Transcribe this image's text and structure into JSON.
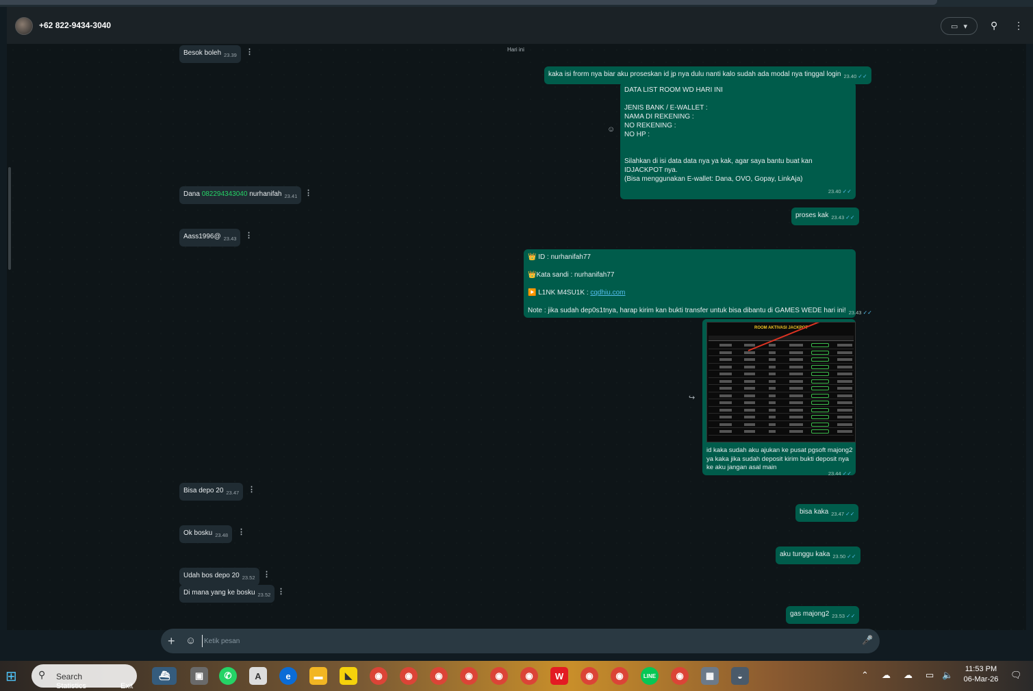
{
  "header": {
    "contact": "+62 822-9434-3040",
    "video_icon": "video-camera-icon",
    "search_icon": "search-icon",
    "menu_icon": "more-vert-icon"
  },
  "chat": {
    "date_chip": "Hari ini",
    "messages": [
      {
        "dir": "in",
        "text": "Besok boleh",
        "time": "23.39"
      },
      {
        "dir": "out",
        "text": "kaka isi frorm nya biar aku proseskan id jp nya dulu nanti kalo sudah ada modal nya tinggal login",
        "time": "23.40"
      },
      {
        "dir": "out",
        "text": "DATA LIST ROOM WD HARI INI\n\nJENIS BANK / E-WALLET :\nNAMA DI REKENING :\nNO REKENING :\nNO HP :\n\n\nSilahkan di isi data data nya ya kak, agar saya bantu buat kan IDJACKPOT nya.\n(Bisa menggunakan E-wallet: Dana, OVO, Gopay, LinkAja)",
        "time": "23.40"
      },
      {
        "dir": "in",
        "prefix": "Dana ",
        "phone": "082294343040",
        "suffix": " nurhanifah",
        "time": "23.41"
      },
      {
        "dir": "out",
        "text": "proses kak",
        "time": "23.43"
      },
      {
        "dir": "in",
        "text": "Aass1996@",
        "time": "23.43"
      },
      {
        "dir": "out",
        "id_line": "👑 ID :  nurhanifah77",
        "pw_line": "👑Kata sandi : nurhanifah77",
        "link_prefix": "▶️ L1NK M4SU1K : ",
        "link": "cqdhiu.com",
        "note": "Note : jika sudah dep0s1tnya, harap kirim kan bukti transfer untuk bisa dibantu di GAMES WEDE hari ini!",
        "time": "23.43"
      },
      {
        "dir": "out",
        "image_title": "ROOM AKTIVASI JACKPOT",
        "text": "id kaka sudah aku ajukan ke pusat pgsoft majong2\nya kaka jika sudah deposit kirim bukti deposit nya\nke aku jangan asal main",
        "time": "23.44"
      },
      {
        "dir": "in",
        "text": "Bisa depo 20",
        "time": "23.47"
      },
      {
        "dir": "out",
        "text": "bisa kaka",
        "time": "23.47"
      },
      {
        "dir": "in",
        "text": "Ok bosku",
        "time": "23.48"
      },
      {
        "dir": "out",
        "text": "aku tunggu kaka",
        "time": "23.50"
      },
      {
        "dir": "in",
        "text": "Udah bos depo 20",
        "time": "23.52"
      },
      {
        "dir": "in",
        "text": "Di mana yang ke bosku",
        "time": "23.52"
      },
      {
        "dir": "out",
        "text": "gas majong2",
        "time": "23.53"
      }
    ]
  },
  "composer": {
    "placeholder": "Ketik pesan"
  },
  "taskbar": {
    "search": "Search",
    "statistics": "Statistics",
    "exit": "Exit",
    "time": "11:53 PM",
    "date": "06-Mar-26"
  }
}
